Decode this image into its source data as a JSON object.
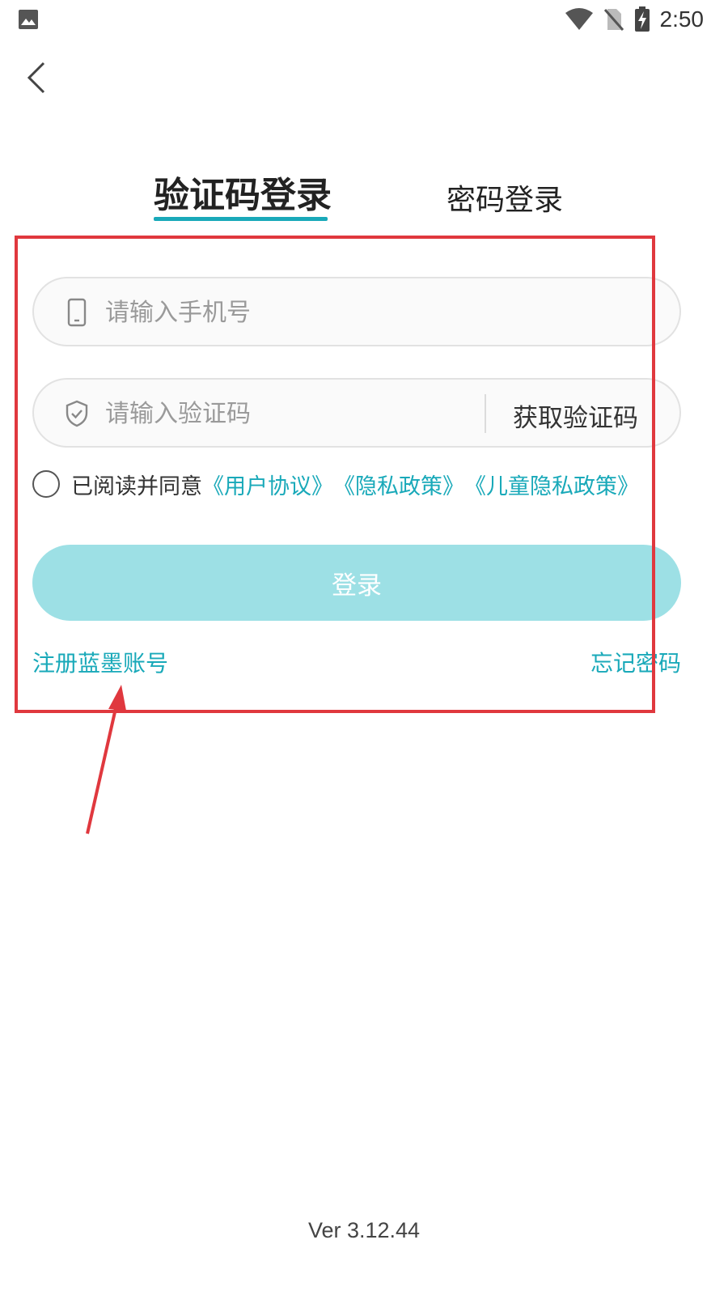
{
  "status_bar": {
    "time": "2:50",
    "icons": [
      "image-icon",
      "wifi-icon",
      "no-sim-icon",
      "battery-charging-icon"
    ]
  },
  "nav": {
    "back_icon": "chevron-left-icon"
  },
  "tabs": [
    {
      "label": "验证码登录",
      "active": true
    },
    {
      "label": "密码登录",
      "active": false
    }
  ],
  "phone_field": {
    "icon": "phone-icon",
    "placeholder": "请输入手机号",
    "value": ""
  },
  "code_field": {
    "icon": "shield-check-icon",
    "placeholder": "请输入验证码",
    "value": "",
    "get_code_label": "获取验证码"
  },
  "agreement": {
    "checked": false,
    "prefix": "已阅读并同意",
    "links": [
      "《用户协议》",
      "《隐私政策》",
      "《儿童隐私政策》"
    ]
  },
  "login_button": {
    "label": "登录"
  },
  "register_link": "注册蓝墨账号",
  "forgot_link": "忘记密码",
  "version": "Ver 3.12.44",
  "colors": {
    "accent": "#19a9b9",
    "login_button_bg": "#9de0e5",
    "annotation": "#e0383e"
  }
}
